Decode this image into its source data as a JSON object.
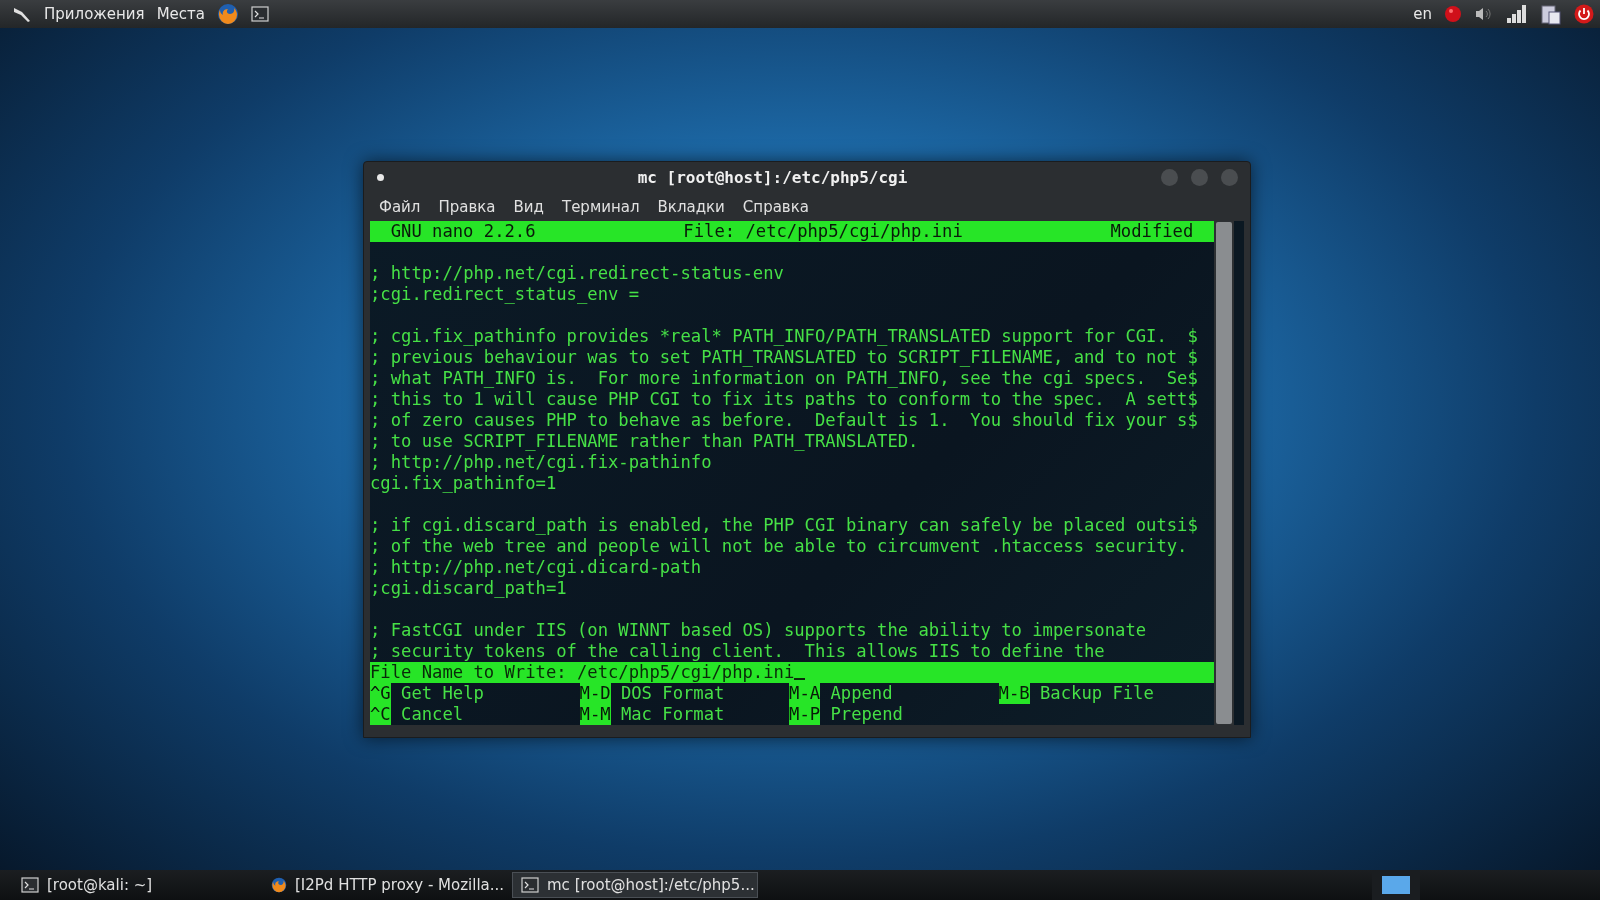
{
  "top_panel": {
    "menus": [
      "Приложения",
      "Места"
    ],
    "keyboard_layout": "en"
  },
  "window": {
    "title": "mc [root@host]:/etc/php5/cgi",
    "menu": [
      "Файл",
      "Правка",
      "Вид",
      "Терминал",
      "Вкладки",
      "Справка"
    ],
    "nano": {
      "header": {
        "version": "GNU nano 2.2.6",
        "file": "File: /etc/php5/cgi/php.ini",
        "status": "Modified"
      },
      "lines": [
        {
          "kind": "blank"
        },
        {
          "kind": "text",
          "text": "; http://php.net/cgi.redirect-status-env"
        },
        {
          "kind": "text",
          "text": ";cgi.redirect_status_env ="
        },
        {
          "kind": "blank"
        },
        {
          "kind": "text",
          "text": "; cgi.fix_pathinfo provides *real* PATH_INFO/PATH_TRANSLATED support for CGI.  $"
        },
        {
          "kind": "text",
          "text": "; previous behaviour was to set PATH_TRANSLATED to SCRIPT_FILENAME, and to not $"
        },
        {
          "kind": "text",
          "text": "; what PATH_INFO is.  For more information on PATH_INFO, see the cgi specs.  Se$"
        },
        {
          "kind": "text",
          "text": "; this to 1 will cause PHP CGI to fix its paths to conform to the spec.  A sett$"
        },
        {
          "kind": "text",
          "text": "; of zero causes PHP to behave as before.  Default is 1.  You should fix your s$"
        },
        {
          "kind": "text",
          "text": "; to use SCRIPT_FILENAME rather than PATH_TRANSLATED."
        },
        {
          "kind": "text",
          "text": "; http://php.net/cgi.fix-pathinfo"
        },
        {
          "kind": "text",
          "text": "cgi.fix_pathinfo=1"
        },
        {
          "kind": "blank"
        },
        {
          "kind": "text",
          "text": "; if cgi.discard_path is enabled, the PHP CGI binary can safely be placed outsi$"
        },
        {
          "kind": "text",
          "text": "; of the web tree and people will not be able to circumvent .htaccess security."
        },
        {
          "kind": "text",
          "text": "; http://php.net/cgi.dicard-path"
        },
        {
          "kind": "text",
          "text": ";cgi.discard_path=1"
        },
        {
          "kind": "blank"
        },
        {
          "kind": "text",
          "text": "; FastCGI under IIS (on WINNT based OS) supports the ability to impersonate"
        },
        {
          "kind": "text",
          "text": "; security tokens of the calling client.  This allows IIS to define the"
        }
      ],
      "prompt": "File Name to Write: /etc/php5/cgi/php.ini",
      "shortcuts": [
        {
          "key": "^G",
          "label": "Get Help"
        },
        {
          "key": "M-D",
          "label": "DOS Format"
        },
        {
          "key": "M-A",
          "label": "Append"
        },
        {
          "key": "M-B",
          "label": "Backup File"
        },
        {
          "key": "^C",
          "label": "Cancel"
        },
        {
          "key": "M-M",
          "label": "Mac Format"
        },
        {
          "key": "M-P",
          "label": "Prepend"
        }
      ]
    }
  },
  "taskbar": {
    "tasks": [
      {
        "kind": "terminal",
        "label": "[root@kali: ~]",
        "selected": false
      },
      {
        "kind": "browser",
        "label": "[I2Pd HTTP proxy - Mozilla...",
        "selected": false
      },
      {
        "kind": "terminal",
        "label": "mc [root@host]:/etc/php5...",
        "selected": true
      }
    ]
  }
}
